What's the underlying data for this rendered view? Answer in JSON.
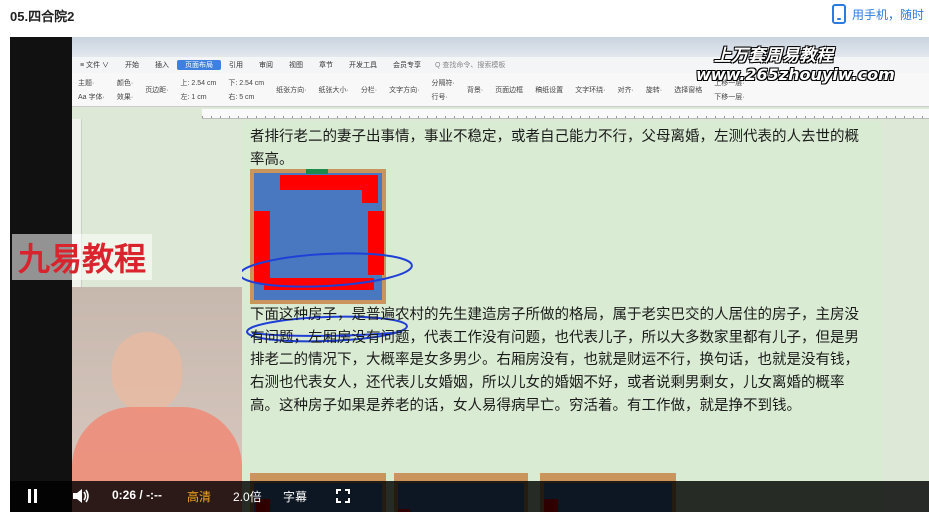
{
  "page": {
    "title": "05.四合院2",
    "mobile_link": "用手机，随时"
  },
  "wps": {
    "tabs": [
      "≡ 文件 ∨",
      "开始",
      "插入",
      "页面布局",
      "引用",
      "审阅",
      "视图",
      "章节",
      "开发工具",
      "会员专享"
    ],
    "search": "Q 查找命令、搜索模板",
    "toolbar": [
      [
        "主题·",
        "Aa 字体·"
      ],
      [
        "颜色·",
        "效果·"
      ],
      [
        "页边距·"
      ],
      [
        "上: 2.54 cm",
        "左: 1 cm"
      ],
      [
        "下: 2.54 cm",
        "右: 5 cm"
      ],
      [
        "纸张方向·"
      ],
      [
        "纸张大小·"
      ],
      [
        "分栏·"
      ],
      [
        "文字方向·"
      ],
      [
        "分隔符·",
        "行号·"
      ],
      [
        "背景·"
      ],
      [
        "页面边框"
      ],
      [
        "稿纸设置"
      ],
      [
        "文字环绕·"
      ],
      [
        "对齐·"
      ],
      [
        "旋转·"
      ],
      [
        "选择窗格"
      ],
      [
        "上移一层·",
        "下移一层·"
      ]
    ]
  },
  "watermark": {
    "title": "上万套周易教程",
    "url": "www.265zhouyiw.com"
  },
  "overlay": {
    "brand": "九易教程"
  },
  "document": {
    "para1": "者排行老二的妻子出事情，事业不稳定，或者自己能力不行，父母离婚，左测代表的人去世的概率高。",
    "para2": "下面这种房子，是普遍农村的先生建造房子所做的格局，属于老实巴交的人居住的房子，主房没有问题，左厢房没有问题，代表工作没有问题，也代表儿子，所以大多数家里都有儿子，但是男排老二的情况下，大概率是女多男少。右厢房没有，也就是财运不行，换句话，也就是没有钱，右测也代表女人，还代表儿女婚姻，所以儿女的婚姻不好，或者说剩男剩女，儿女离婚的概率高。这种房子如果是养老的话，女人易得病早亡。穷活着。有工作做，就是挣不到钱。"
  },
  "colors": {
    "wall": "#ff0000",
    "courtyard": "#4a78c0",
    "frame": "#c9955d",
    "annotation": "#1f3fd6"
  },
  "player": {
    "current_time": "0:26",
    "separator": "/",
    "total_time": "-:--",
    "quality": "高清",
    "speed": "2.0倍",
    "subtitle": "字幕",
    "icons": [
      "pause-icon",
      "volume-icon",
      "fullscreen-icon"
    ]
  }
}
